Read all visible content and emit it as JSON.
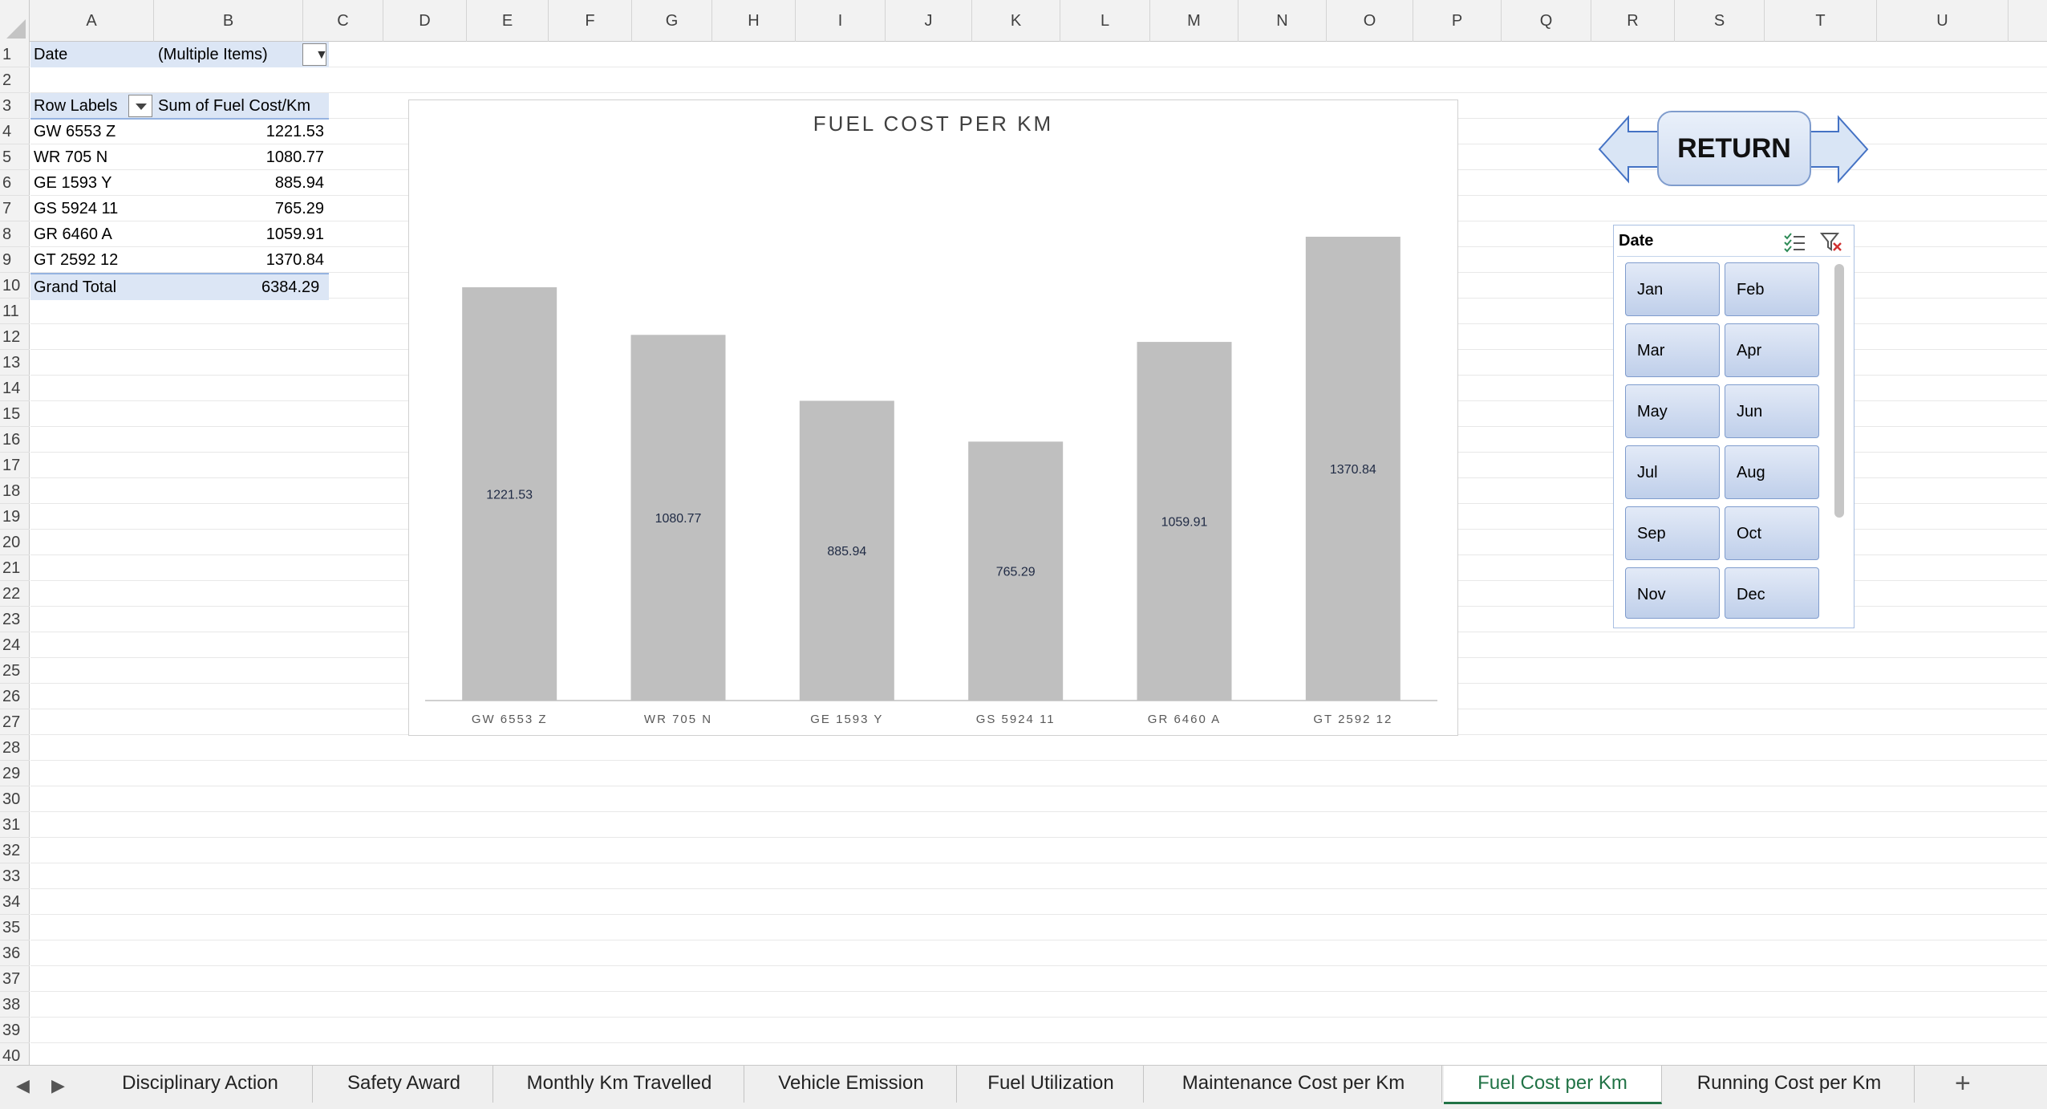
{
  "grid": {
    "columns": [
      "A",
      "B",
      "C",
      "D",
      "E",
      "F",
      "G",
      "H",
      "I",
      "J",
      "K",
      "L",
      "M",
      "N",
      "O",
      "P",
      "Q",
      "R",
      "S",
      "T",
      "U"
    ],
    "rows": [
      "1",
      "2",
      "3",
      "4",
      "5",
      "6",
      "7",
      "8",
      "9",
      "10",
      "11",
      "12",
      "13",
      "14",
      "15",
      "16",
      "17",
      "18",
      "19",
      "20",
      "21",
      "22",
      "23",
      "24",
      "25",
      "26",
      "27",
      "28",
      "29",
      "30",
      "31",
      "32",
      "33",
      "34",
      "35",
      "36",
      "37",
      "38",
      "39",
      "40"
    ]
  },
  "pivot": {
    "filter_label": "Date",
    "filter_value": "(Multiple Items)",
    "row_labels_header": "Row Labels",
    "sum_header": "Sum of Fuel Cost/Km",
    "rows": [
      {
        "label": "GW 6553 Z",
        "value": "1221.53"
      },
      {
        "label": "WR 705 N",
        "value": "1080.77"
      },
      {
        "label": "GE 1593 Y",
        "value": "885.94"
      },
      {
        "label": "GS 5924 11",
        "value": "765.29"
      },
      {
        "label": "GR 6460 A",
        "value": "1059.91"
      },
      {
        "label": "GT 2592 12",
        "value": "1370.84"
      }
    ],
    "grand_total_label": "Grand Total",
    "grand_total_value": "6384.29"
  },
  "chart_data": {
    "type": "bar",
    "title": "FUEL COST PER KM",
    "categories": [
      "GW 6553 Z",
      "WR 705 N",
      "GE 1593 Y",
      "GS 5924 11",
      "GR 6460 A",
      "GT 2592 12"
    ],
    "values": [
      1221.53,
      1080.77,
      885.94,
      765.29,
      1059.91,
      1370.84
    ],
    "data_labels": [
      "1221.53",
      "1080.77",
      "885.94",
      "765.29",
      "1059.91",
      "1370.84"
    ],
    "bar_color": "#bfbfbf",
    "xlabel": "",
    "ylabel": "",
    "ylim": [
      0,
      1370.84
    ],
    "grid": false,
    "legend": "none"
  },
  "return_button": {
    "label": "RETURN"
  },
  "slicer": {
    "title": "Date",
    "items": [
      "Jan",
      "Feb",
      "Mar",
      "Apr",
      "May",
      "Jun",
      "Jul",
      "Aug",
      "Sep",
      "Oct",
      "Nov",
      "Dec"
    ],
    "icons": [
      "multi-select-icon",
      "clear-filter-icon"
    ]
  },
  "tabs": {
    "items": [
      "Disciplinary Action",
      "Safety Award",
      "Monthly Km Travelled",
      "Vehicle Emission",
      "Fuel Utilization",
      "Maintenance Cost per Km",
      "Fuel Cost per Km",
      "Running Cost per Km"
    ],
    "active": "Fuel Cost per Km",
    "nav_prev": "◀",
    "nav_next": "▶",
    "add": "+"
  },
  "colors": {
    "active_tab": "#217346",
    "pivot_band": "#dce6f5",
    "slicer_button": "#bfcfea",
    "return_shape": "#cfdcf1"
  }
}
